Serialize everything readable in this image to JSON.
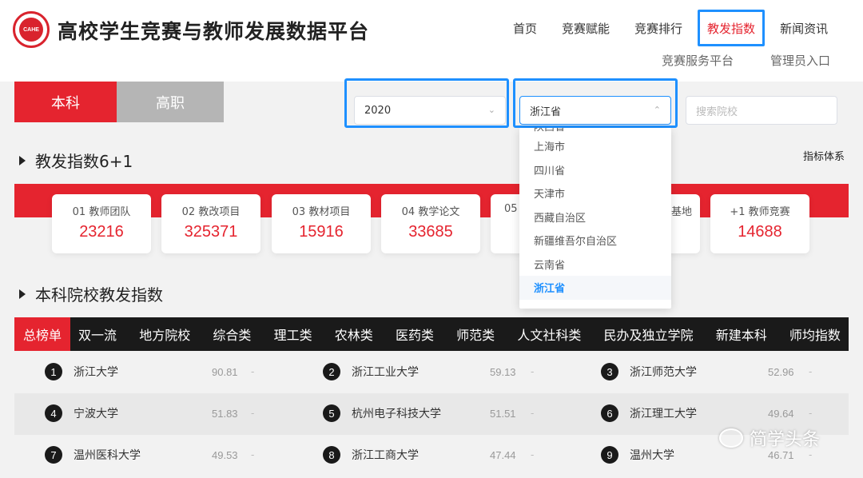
{
  "header": {
    "logo_text": "CAHE",
    "title": "高校学生竞赛与教师发展数据平台",
    "nav": [
      "首页",
      "竞赛赋能",
      "竞赛排行",
      "教发指数",
      "新闻资讯"
    ],
    "subnav": [
      "竞赛服务平台",
      "管理员入口"
    ]
  },
  "tabs": {
    "undergrad": "本科",
    "vocational": "高职"
  },
  "filters": {
    "year": "2020",
    "province": "浙江省",
    "search_placeholder": "搜索院校"
  },
  "dropdown": {
    "partial_top": "陕西省",
    "options": [
      "上海市",
      "四川省",
      "天津市",
      "西藏自治区",
      "新疆维吾尔自治区",
      "云南省",
      "浙江省"
    ],
    "selected": "浙江省"
  },
  "section1": {
    "title": "教发指数6+1",
    "link": "指标体系"
  },
  "stats": [
    {
      "label": "01 教师团队",
      "value": "23216"
    },
    {
      "label": "02 教改项目",
      "value": "325371"
    },
    {
      "label": "03 教材项目",
      "value": "15916"
    },
    {
      "label": "04 教学论文",
      "value": "33685"
    },
    {
      "label": "05",
      "value": ""
    },
    {
      "label": "基地",
      "value": ""
    },
    {
      "label": "+1 教师竞赛",
      "value": "14688"
    }
  ],
  "section2": {
    "title": "本科院校教发指数"
  },
  "categories": [
    "总榜单",
    "双一流",
    "地方院校",
    "综合类",
    "理工类",
    "农林类",
    "医药类",
    "师范类",
    "人文社科类",
    "民办及独立学院",
    "新建本科",
    "师均指数"
  ],
  "rankings": [
    [
      {
        "rank": "1",
        "name": "浙江大学",
        "score": "90.81",
        "dash": "-"
      },
      {
        "rank": "2",
        "name": "浙江工业大学",
        "score": "59.13",
        "dash": "-"
      },
      {
        "rank": "3",
        "name": "浙江师范大学",
        "score": "52.96",
        "dash": "-"
      }
    ],
    [
      {
        "rank": "4",
        "name": "宁波大学",
        "score": "51.83",
        "dash": "-"
      },
      {
        "rank": "5",
        "name": "杭州电子科技大学",
        "score": "51.51",
        "dash": "-"
      },
      {
        "rank": "6",
        "name": "浙江理工大学",
        "score": "49.64",
        "dash": "-"
      }
    ],
    [
      {
        "rank": "7",
        "name": "温州医科大学",
        "score": "49.53",
        "dash": "-"
      },
      {
        "rank": "8",
        "name": "浙江工商大学",
        "score": "47.44",
        "dash": "-"
      },
      {
        "rank": "9",
        "name": "温州大学",
        "score": "46.71",
        "dash": "-"
      }
    ]
  ],
  "watermark": "简学头条",
  "colors": {
    "brand_red": "#e5242f",
    "highlight_blue": "#1e90ff",
    "dark": "#1a1a1a"
  }
}
